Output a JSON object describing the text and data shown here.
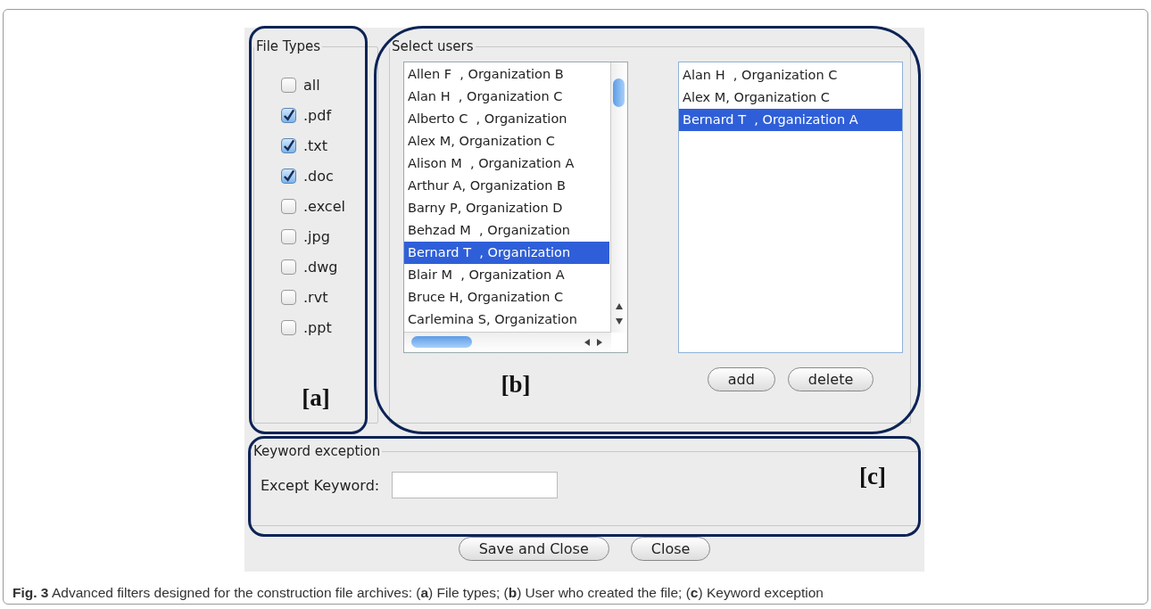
{
  "file_types": {
    "legend": "File Types",
    "annotation": "[a]",
    "items": [
      {
        "label": "all",
        "checked": false
      },
      {
        "label": ".pdf",
        "checked": true
      },
      {
        "label": ".txt",
        "checked": true
      },
      {
        "label": ".doc",
        "checked": true
      },
      {
        "label": ".excel",
        "checked": false
      },
      {
        "label": ".jpg",
        "checked": false
      },
      {
        "label": ".dwg",
        "checked": false
      },
      {
        "label": ".rvt",
        "checked": false
      },
      {
        "label": ".ppt",
        "checked": false
      }
    ]
  },
  "select_users": {
    "legend": "Select users",
    "annotation": "[b]",
    "available": [
      {
        "label": "Allen F  , Organization B",
        "selected": false
      },
      {
        "label": "Alan H  , Organization C",
        "selected": false
      },
      {
        "label": "Alberto C  , Organization",
        "selected": false
      },
      {
        "label": "Alex M, Organization C",
        "selected": false
      },
      {
        "label": "Alison M  , Organization A",
        "selected": false
      },
      {
        "label": "Arthur A, Organization B",
        "selected": false
      },
      {
        "label": "Barny P, Organization D",
        "selected": false
      },
      {
        "label": "Behzad M  , Organization",
        "selected": false
      },
      {
        "label": "Bernard T  , Organization",
        "selected": true
      },
      {
        "label": "Blair M  , Organization A",
        "selected": false
      },
      {
        "label": "Bruce H, Organization C",
        "selected": false
      },
      {
        "label": "Carlemina S, Organization",
        "selected": false
      }
    ],
    "chosen": [
      {
        "label": "Alan H  , Organization C",
        "selected": false
      },
      {
        "label": "Alex M, Organization C",
        "selected": false
      },
      {
        "label": "Bernard T  , Organization A",
        "selected": true
      }
    ],
    "buttons": [
      "add",
      "delete"
    ]
  },
  "keyword_exception": {
    "legend": "Keyword exception",
    "label": "Except Keyword:",
    "annotation": "[c]"
  },
  "buttons": [
    "Save and Close",
    "Close"
  ],
  "caption": "**Fig. 3** Advanced filters designed for the construction file archives: (**a**) File types; (**b**) User who created the file; (**c**) Keyword exception"
}
